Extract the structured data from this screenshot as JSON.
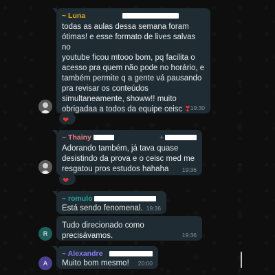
{
  "messages": [
    {
      "sender": "~ Luna",
      "sender_color": "#e4ab1f",
      "lines": [
        "todas as aulas dessa semana foram",
        "ótimas! e esse formato de lives salvas no",
        "youtube ficou mtooo bom, pq facilita o",
        "acesso pra quem não pode no horário, e",
        "também permite q a gente vá pausando",
        "pra revisar os conteúdos",
        "simultaneamente, showw!! muito",
        "obrigadaa a todos da equipe ceisc"
      ],
      "emoji": "❣",
      "time": "19:30",
      "reaction": "❤"
    },
    {
      "sender": "~ Thainy",
      "sender_color": "#ef7b85",
      "phone_prefix": "+",
      "lines": [
        "Adorando também, já tava quase",
        "desistindo da prova e o ceisc med me",
        "resgatou pros estudos hahaha"
      ],
      "time": "19:36",
      "reaction": "❤"
    },
    {
      "sender": "~ romulo",
      "sender_color": "#25a99b",
      "lines": [
        "Está sendo fenomenal."
      ],
      "time": "19:36"
    },
    {
      "avatar_letter": "R",
      "avatar_color": "#1f5f5b",
      "lines": [
        "Tudo direcionado como precisávamos."
      ],
      "time": "19:36"
    },
    {
      "sender": "~ Alexandre",
      "sender_color": "#8a7df0",
      "avatar_letter": "A",
      "avatar_color": "#4b3f8f",
      "lines": [
        "Muito bom mesmo!"
      ],
      "time": "20:00"
    }
  ]
}
